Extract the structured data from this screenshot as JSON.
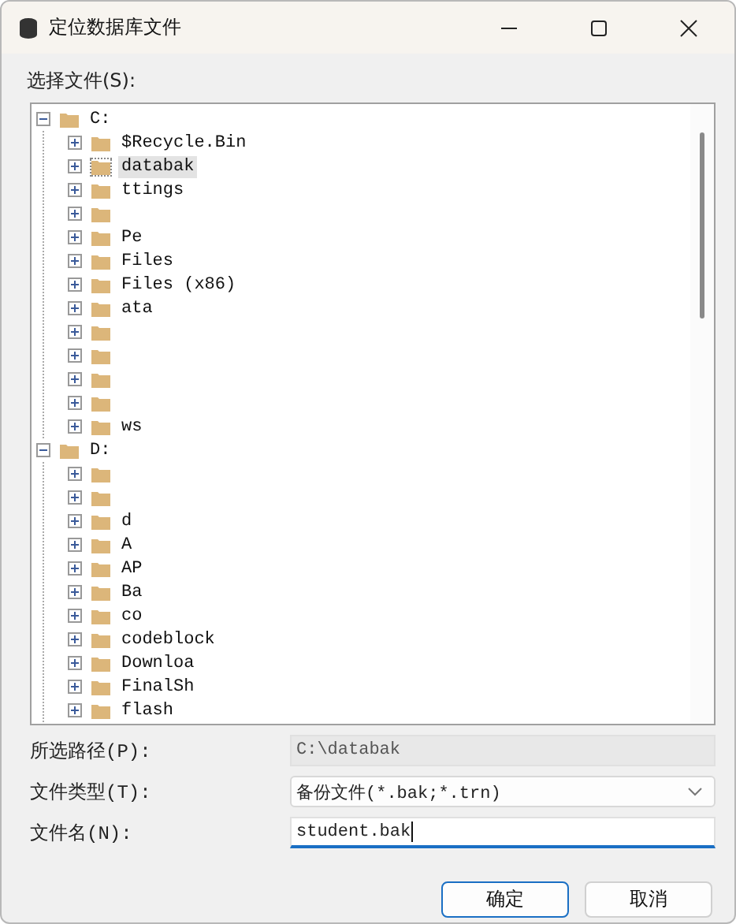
{
  "window": {
    "title": "定位数据库文件"
  },
  "tree_label": "选择文件(S):",
  "tree": [
    {
      "label": "C:",
      "expanded": true,
      "selected": false,
      "children": [
        {
          "label": "$Recycle.Bin",
          "expanded": false,
          "selected": false
        },
        {
          "label": "databak",
          "expanded": false,
          "selected": true
        },
        {
          "label": "ttings",
          "expanded": false,
          "selected": false
        },
        {
          "expanded": false,
          "selected": false
        },
        {
          "label": "Pe",
          "expanded": false,
          "selected": false
        },
        {
          "label": "Files",
          "expanded": false,
          "selected": false
        },
        {
          "label": "Files (x86)",
          "expanded": false,
          "selected": false
        },
        {
          "label": "ata",
          "expanded": false,
          "selected": false
        },
        {
          "expanded": false,
          "selected": false
        },
        {
          "expanded": false,
          "selected": false
        },
        {
          "expanded": false,
          "selected": false
        },
        {
          "expanded": false,
          "selected": false
        },
        {
          "label": "ws",
          "expanded": false,
          "selected": false
        }
      ]
    },
    {
      "label": "D:",
      "expanded": true,
      "selected": false,
      "children": [
        {
          "expanded": false,
          "selected": false
        },
        {
          "expanded": false,
          "selected": false
        },
        {
          "label": "d",
          "expanded": false,
          "selected": false
        },
        {
          "label": "A",
          "expanded": false,
          "selected": false
        },
        {
          "label": "AP",
          "expanded": false,
          "selected": false
        },
        {
          "label": "Ba",
          "expanded": false,
          "selected": false
        },
        {
          "label": "co",
          "expanded": false,
          "selected": false
        },
        {
          "label": "codeblock",
          "expanded": false,
          "selected": false
        },
        {
          "label": "Downloa",
          "expanded": false,
          "selected": false
        },
        {
          "label": "FinalSh",
          "expanded": false,
          "selected": false
        },
        {
          "label": "flash",
          "expanded": false,
          "selected": false
        }
      ]
    }
  ],
  "fields": [
    {
      "kind": "readonly",
      "label": "所选路径(P):",
      "value": "C:\\databak"
    },
    {
      "kind": "dropdown",
      "label": "文件类型(T):",
      "value": "备份文件(*.bak;*.trn)"
    },
    {
      "kind": "input",
      "label": "文件名(N):",
      "value": "student.bak"
    }
  ],
  "buttons": [
    {
      "label": "确定",
      "default": true
    },
    {
      "label": "取消",
      "default": false
    }
  ]
}
